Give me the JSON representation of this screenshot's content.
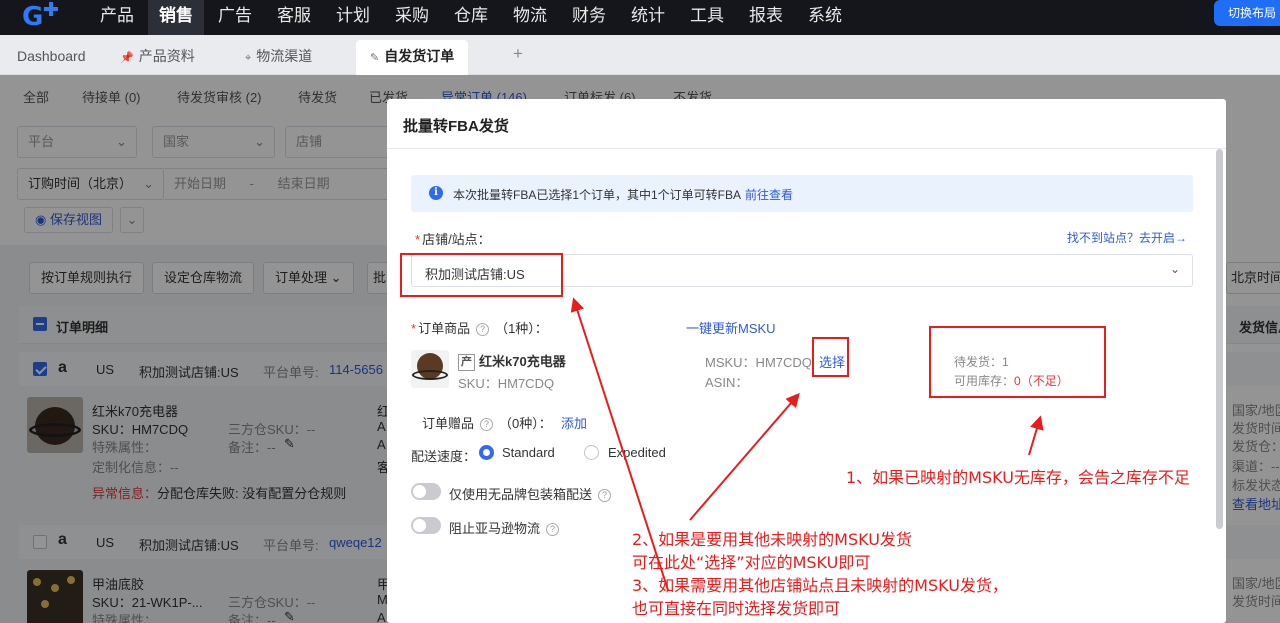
{
  "nav": {
    "items": [
      "产品",
      "销售",
      "广告",
      "客服",
      "计划",
      "采购",
      "仓库",
      "物流",
      "财务",
      "统计",
      "工具",
      "报表",
      "系统"
    ],
    "active_index": 1,
    "switch_label": "切换布局"
  },
  "tabs": {
    "items": [
      "Dashboard",
      "产品资料",
      "物流渠道",
      "自发货订单"
    ],
    "active": "自发货订单"
  },
  "status_tabs": [
    "全部",
    "待接单 (0)",
    "待发货审核 (2)",
    "待发货",
    "已发货",
    "异常订单 (146)",
    "订单标发 (6)",
    "不发货"
  ],
  "filters": {
    "platform": "平台",
    "country": "国家",
    "shop": "店铺",
    "time_type": "订购时间（北京）",
    "start_date": "开始日期",
    "sep": "-",
    "end_date": "结束日期"
  },
  "save_view": "保存视图",
  "actions": [
    "按订单规则执行",
    "设定仓库物流",
    "订单处理",
    "批"
  ],
  "right_col": {
    "time": "北京时间",
    "ship_info": "发货信息",
    "r1": [
      "国家/地区",
      "发货时间",
      "发货仓：",
      "渠道：--",
      "标发状态",
      "查看地址"
    ],
    "r2": [
      "国家/地区",
      "发货时间"
    ]
  },
  "order_list": {
    "header": "订单明细",
    "row1": {
      "country": "US",
      "shop": "积加测试店铺:US",
      "platform_no_label": "平台单号:",
      "platform_no": "114-5656",
      "product": "红米k70充电器",
      "sku": "SKU：HM7CDQ",
      "third_sku": "三方仓SKU：--",
      "special": "特殊属性：",
      "remark": "备注：--",
      "custom": "定制化信息：--",
      "error_label": "异常信息：",
      "error_text": "分配仓库失败: 没有配置分仓规则",
      "col2": [
        "红",
        "A",
        "A",
        "客"
      ]
    },
    "row2": {
      "country": "US",
      "shop": "积加测试店铺:US",
      "platform_no_label": "平台单号:",
      "platform_no": "qweqe12",
      "product": "甲油底胶",
      "sku": "SKU：21-WK1P-...",
      "third_sku": "三方仓SKU：--",
      "special": "特殊属性：",
      "remark": "备注：--",
      "col2": [
        "甲",
        "M",
        "A"
      ]
    }
  },
  "modal": {
    "title": "批量转FBA发货",
    "info": "本次批量转FBA已选择1个订单，其中1个订单可转FBA",
    "info_link": "前往查看",
    "shop_label": "店铺/站点：",
    "shop_link": "找不到站点？去开启→",
    "shop_value": "积加测试店铺:US",
    "products_label": "订单商品",
    "products_count": "（1种）：",
    "update_msku": "一键更新MSKU",
    "product": {
      "channel_tag": "产",
      "name": "红米k70充电器",
      "sku": "SKU：HM7CDQ",
      "msku_label": "MSKU：HM7CDQ",
      "select": "选择",
      "asin": "ASIN：",
      "pending": "待发货：1",
      "stock_label": "可用库存：",
      "stock_value": "0",
      "stock_note": "（不足）"
    },
    "gifts_label": "订单赠品",
    "gifts_count": "（0种）：",
    "gifts_add": "添加",
    "speed_label": "配送速度：",
    "speed_options": [
      "Standard",
      "Expedited"
    ],
    "toggle1": "仅使用无品牌包装箱配送",
    "toggle2": "阻止亚马逊物流"
  },
  "annotations": {
    "note1": "1、如果已映射的MSKU无库存，会告之库存不足",
    "note2_line1": "2、如果是要用其他未映射的MSKU发货",
    "note2_line2": "可在此处“选择”对应的MSKU即可",
    "note3_line1": "3、如果需要用其他店铺站点且未映射的MSKU发货，",
    "note3_line2": "也可直接在同时选择发货即可",
    "color": "#e81c1c"
  }
}
